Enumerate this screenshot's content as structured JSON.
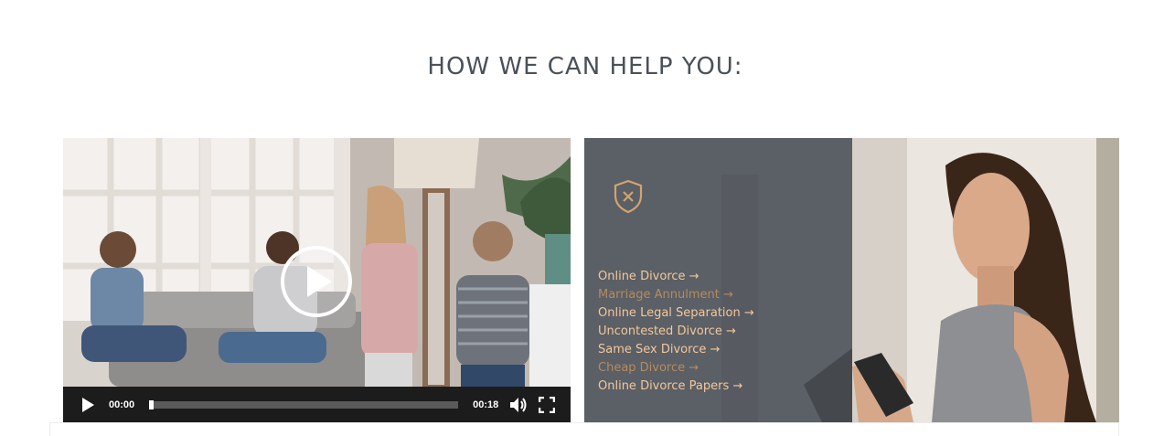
{
  "section": {
    "heading": "HOW WE CAN HELP YOU:"
  },
  "video": {
    "current_time": "00:00",
    "duration": "00:18",
    "progress_fraction": 0.0,
    "icons": [
      "play-icon",
      "volume-icon",
      "fullscreen-icon"
    ]
  },
  "services": {
    "icon": "shield-x-icon",
    "accent_color": "#d4a46c",
    "items": [
      {
        "label": "Online Divorce →",
        "state": "active"
      },
      {
        "label": "Marriage Annulment →",
        "state": "muted"
      },
      {
        "label": "Online Legal Separation →",
        "state": "active"
      },
      {
        "label": "Uncontested Divorce →",
        "state": "active"
      },
      {
        "label": "Same Sex Divorce →",
        "state": "active"
      },
      {
        "label": "Cheap Divorce →",
        "state": "muted"
      },
      {
        "label": "Online Divorce Papers →",
        "state": "active"
      }
    ]
  }
}
